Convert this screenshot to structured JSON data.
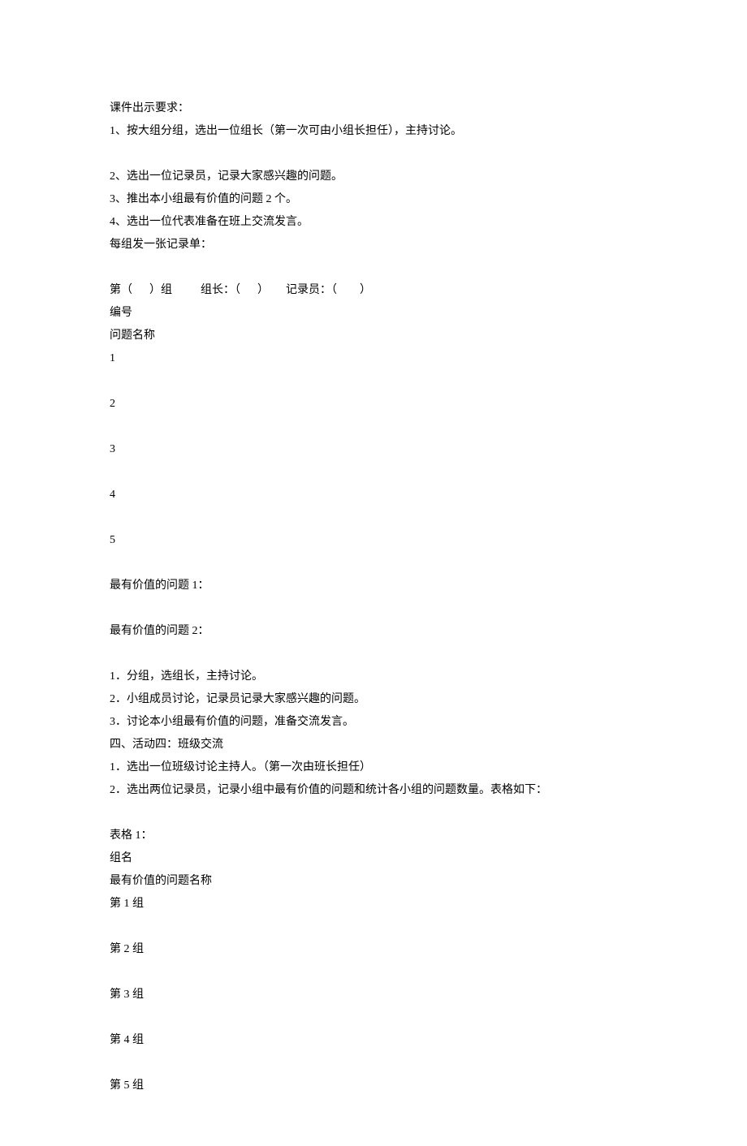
{
  "title": "课件出示要求：",
  "rules": [
    "1、按大组分组，选出一位组长（第一次可由小组长担任），主持讨论。",
    "2、选出一位记录员，记录大家感兴趣的问题。",
    "3、推出本小组最有价值的问题 2 个。",
    "4、选出一位代表准备在班上交流发言。"
  ],
  "record_sheet_intro": "每组发一张记录单：",
  "form_header": {
    "group_prefix": "第（",
    "group_suffix": "）组",
    "leader_prefix": "组长：（",
    "leader_suffix": "）",
    "recorder_prefix": "记录员：（",
    "recorder_suffix": "）"
  },
  "labels": {
    "number": "编号",
    "question_name": "问题名称"
  },
  "row_numbers": [
    "1",
    "2",
    "3",
    "4",
    "5"
  ],
  "valuable_q1": "最有价值的问题 1：",
  "valuable_q2": "最有价值的问题 2：",
  "steps": [
    "1．分组，选组长，主持讨论。",
    "2．小组成员讨论，记录员记录大家感兴趣的问题。",
    "3．讨论本小组最有价值的问题，准备交流发言。"
  ],
  "activity_four": "四、活动四：班级交流",
  "activity_steps": [
    "1．选出一位班级讨论主持人。（第一次由班长担任）",
    "2．选出两位记录员，记录小组中最有价值的问题和统计各小组的问题数量。表格如下："
  ],
  "table1": {
    "title": "表格 1：",
    "col1": "组名",
    "col2": "最有价值的问题名称",
    "groups": [
      "第 1 组",
      "第 2 组",
      "第 3 组",
      "第 4 组",
      "第 5 组"
    ]
  }
}
